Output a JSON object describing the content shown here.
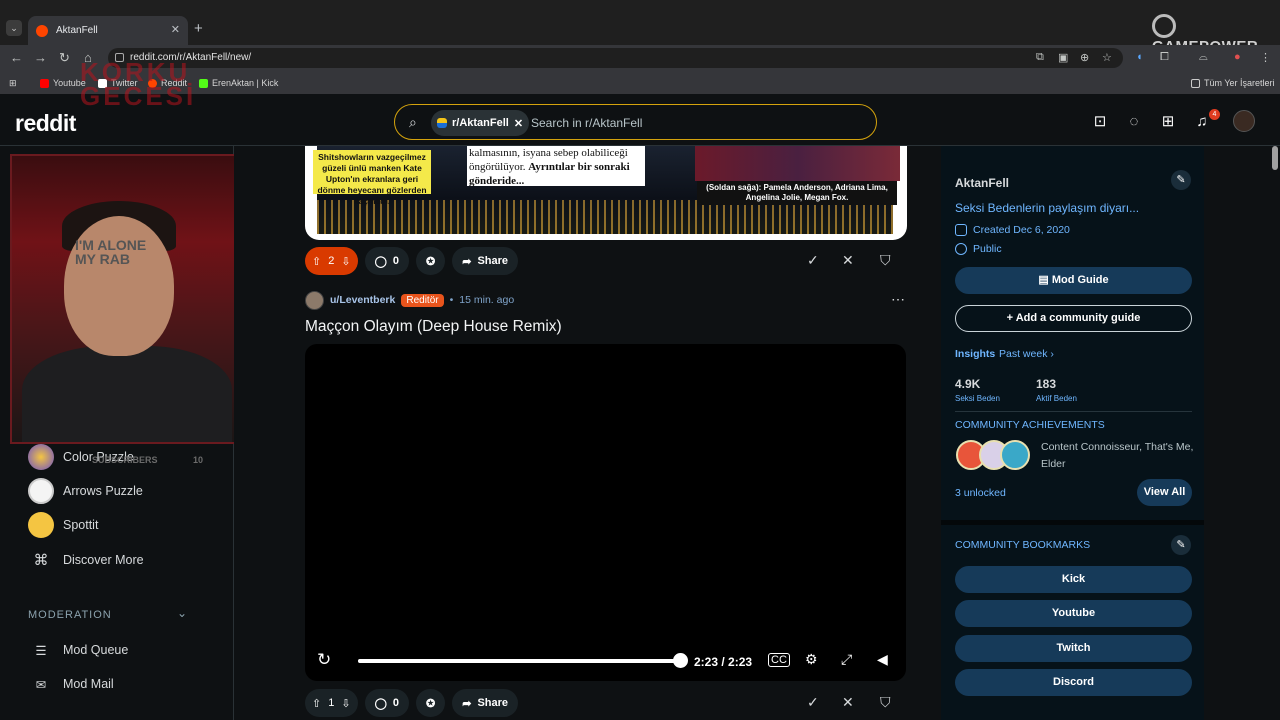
{
  "browser": {
    "tab_title": "AktanFell",
    "url": "reddit.com/r/AktanFell/new/",
    "bookmarks": [
      {
        "label": "Youtube",
        "color": "#ff0000"
      },
      {
        "label": "Twitter",
        "color": "#ffffff"
      },
      {
        "label": "Reddit",
        "color": "#ff4500"
      },
      {
        "label": "ErenAktan | Kick",
        "color": "#53fc18"
      }
    ],
    "all_bookmarks_label": "Tüm Yer İşaretleri",
    "overlay_logo": "GAMEPOWER"
  },
  "stream_overlay": {
    "title_line1": "KORKU",
    "title_line2": "GECESİ",
    "shirt_text": "I'M ALONE\nMY RAB",
    "caption": "SUBSCRIBERS",
    "count": "10"
  },
  "header": {
    "logo": "reddit",
    "search_chip": "r/AktanFell",
    "search_placeholder": "Search in r/AktanFell",
    "notification_count": "4"
  },
  "left_nav": {
    "games": [
      {
        "label": "Color Puzzle",
        "icon": "color-puzzle-icon"
      },
      {
        "label": "Arrows Puzzle",
        "icon": "arrows-puzzle-icon"
      },
      {
        "label": "Spottit",
        "icon": "spottit-icon"
      },
      {
        "label": "Discover More",
        "icon": "gamepad-icon"
      }
    ],
    "moderation_header": "MODERATION",
    "moderation_items": [
      {
        "label": "Mod Queue",
        "icon": "queue-icon"
      },
      {
        "label": "Mod Mail",
        "icon": "mail-icon"
      }
    ]
  },
  "previous_post": {
    "caption_left": "Shitshowların vazgeçilmez güzeli ünlü manken Kate Upton'ın ekranlara geri dönme heyecanı gözlerden kaçmadı.",
    "caption_middle_1": "kalmasının, isyana sebep olabiliceği",
    "caption_middle_2": "öngörülüyor.",
    "caption_middle_bold": "Ayrıntılar bir sonraki gönderide...",
    "caption_right": "(Soldan sağa): Pamela Anderson, Adriana Lima, Angelina Jolie, Megan Fox.",
    "votes": "2",
    "comments": "0",
    "share_label": "Share"
  },
  "post": {
    "author": "u/Leventberk",
    "flair": "Reditör",
    "time": "15 min. ago",
    "title": "Maççon Olayım (Deep House Remix)",
    "video_time": "2:23 / 2:23",
    "progress_fraction": 1.0,
    "votes": "1",
    "comments": "0",
    "share_label": "Share"
  },
  "sidebar": {
    "name": "AktanFell",
    "description": "Seksi Bedenlerin paylaşım diyarı...",
    "created": "Created Dec 6, 2020",
    "visibility": "Public",
    "mod_guide_label": "Mod Guide",
    "community_guide_label": "Add a community guide",
    "insights_label": "Insights",
    "insights_period": "Past week",
    "stats": [
      {
        "value": "4.9K",
        "label": "Seksi Beden"
      },
      {
        "value": "183",
        "label": "Aktif Beden"
      }
    ],
    "achievements_header": "COMMUNITY ACHIEVEMENTS",
    "achievements_text": "Content Connoisseur, That's Me, Elder",
    "unlocked": "3 unlocked",
    "view_all_label": "View All",
    "bookmarks_header": "COMMUNITY BOOKMARKS",
    "bookmarks": [
      "Kick",
      "Youtube",
      "Twitch",
      "Discord"
    ]
  }
}
